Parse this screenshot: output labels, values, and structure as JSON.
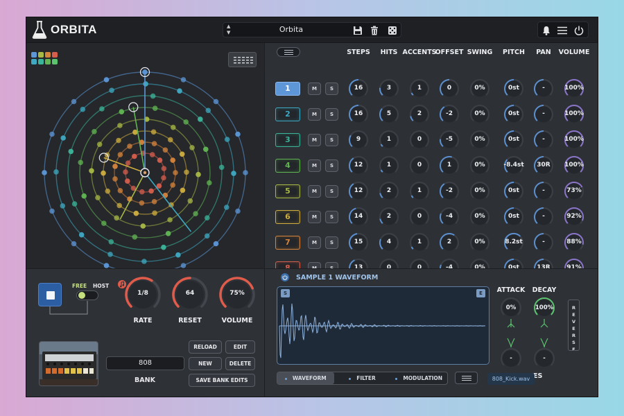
{
  "app": {
    "title": "ORBITA"
  },
  "preset": {
    "name": "Orbita"
  },
  "columns": [
    "STEPS",
    "HITS",
    "ACCENTS",
    "OFFSET",
    "SWING",
    "PITCH",
    "PAN",
    "VOLUME"
  ],
  "tracks": [
    {
      "num": "1",
      "mute": "M",
      "solo": "S",
      "color": "#5d97d8",
      "steps": "16",
      "hits": "3",
      "accents": "1",
      "offset": "0",
      "swing": "0%",
      "pitch": "0st",
      "pan": "-",
      "volume": "100%"
    },
    {
      "num": "2",
      "mute": "M",
      "solo": "S",
      "color": "#3ea9c2",
      "steps": "16",
      "hits": "5",
      "accents": "2",
      "offset": "-2",
      "swing": "0%",
      "pitch": "0st",
      "pan": "-",
      "volume": "100%"
    },
    {
      "num": "3",
      "mute": "M",
      "solo": "S",
      "color": "#3bb59a",
      "steps": "9",
      "hits": "1",
      "accents": "0",
      "offset": "-5",
      "swing": "0%",
      "pitch": "0st",
      "pan": "-",
      "volume": "100%"
    },
    {
      "num": "4",
      "mute": "M",
      "solo": "S",
      "color": "#61b653",
      "steps": "12",
      "hits": "1",
      "accents": "0",
      "offset": "1",
      "swing": "0%",
      "pitch": "-8.4st",
      "pan": "30R",
      "volume": "100%"
    },
    {
      "num": "5",
      "mute": "M",
      "solo": "S",
      "color": "#a8b844",
      "steps": "12",
      "hits": "2",
      "accents": "1",
      "offset": "-2",
      "swing": "0%",
      "pitch": "0st",
      "pan": "-",
      "volume": "73%"
    },
    {
      "num": "6",
      "mute": "M",
      "solo": "S",
      "color": "#cfae3f",
      "steps": "14",
      "hits": "2",
      "accents": "0",
      "offset": "-4",
      "swing": "0%",
      "pitch": "0st",
      "pan": "-",
      "volume": "92%"
    },
    {
      "num": "7",
      "mute": "M",
      "solo": "S",
      "color": "#d5843c",
      "steps": "15",
      "hits": "4",
      "accents": "1",
      "offset": "2",
      "swing": "0%",
      "pitch": "8.2st",
      "pan": "-",
      "volume": "88%"
    },
    {
      "num": "8",
      "mute": "M",
      "solo": "S",
      "color": "#d55e4d",
      "steps": "13",
      "hits": "0",
      "accents": "0",
      "offset": "-4",
      "swing": "0%",
      "pitch": "0st",
      "pan": "13R",
      "volume": "91%"
    }
  ],
  "transport": {
    "free_label": "FREE",
    "host_label": "HOST",
    "rate_value": "1/8",
    "rate_label": "RATE",
    "reset_value": "64",
    "reset_label": "RESET",
    "volume_value": "75%",
    "volume_label": "VOLUME"
  },
  "bank": {
    "name": "808",
    "label": "BANK",
    "reload": "RELOAD",
    "edit": "EDIT",
    "new": "NEW",
    "delete": "DELETE",
    "save": "SAVE BANK EDITS"
  },
  "sample": {
    "title": "SAMPLE 1 WAVEFORM",
    "start_marker": "S",
    "end_marker": "E",
    "attack_label": "ATTACK",
    "decay_label": "DECAY",
    "attack_value": "0%",
    "decay_value": "100%",
    "attack_curve": "-",
    "decay_curve": "-",
    "curves_label": "CURVES",
    "reverse_label": "REVERSE",
    "file": "808_Kick.wav",
    "tabs": [
      "WAVEFORM",
      "FILTER",
      "MODULATION"
    ]
  },
  "colors": {
    "accent": "#5d97d8",
    "knob_red": "#e15b4b",
    "purple": "#8a74c8",
    "green": "#5cc36f"
  }
}
